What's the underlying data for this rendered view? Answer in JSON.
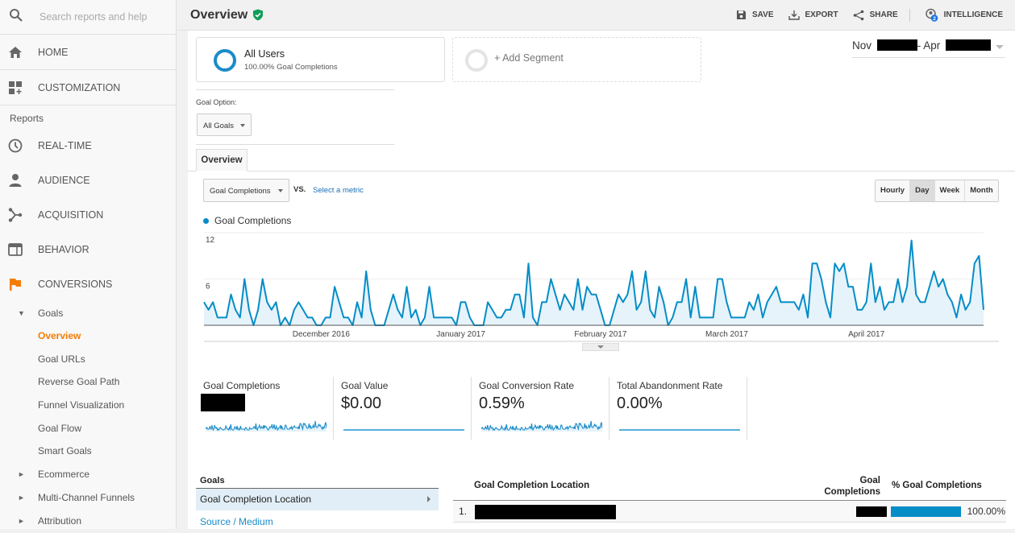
{
  "sidebar": {
    "search_placeholder": "Search reports and help",
    "top_items": [
      {
        "label": "HOME",
        "icon": "home-icon"
      },
      {
        "label": "CUSTOMIZATION",
        "icon": "dashboard-add-icon"
      }
    ],
    "reports_label": "Reports",
    "report_items": [
      {
        "label": "REAL-TIME",
        "icon": "clock-icon"
      },
      {
        "label": "AUDIENCE",
        "icon": "person-icon"
      },
      {
        "label": "ACQUISITION",
        "icon": "acquisition-icon"
      },
      {
        "label": "BEHAVIOR",
        "icon": "browser-window-icon"
      },
      {
        "label": "CONVERSIONS",
        "icon": "flag-icon"
      }
    ],
    "goals_label": "Goals",
    "goal_items": [
      "Overview",
      "Goal URLs",
      "Reverse Goal Path",
      "Funnel Visualization",
      "Goal Flow",
      "Smart Goals"
    ],
    "active_goal_item": "Overview",
    "collapsed_items": [
      "Ecommerce",
      "Multi-Channel Funnels",
      "Attribution"
    ]
  },
  "header": {
    "title": "Overview",
    "actions": [
      {
        "label": "SAVE",
        "icon": "save-icon"
      },
      {
        "label": "EXPORT",
        "icon": "export-icon"
      },
      {
        "label": "SHARE",
        "icon": "share-icon"
      },
      {
        "label": "INTELLIGENCE",
        "icon": "intelligence-icon",
        "badge": "2"
      }
    ]
  },
  "segments": {
    "active": {
      "name": "All Users",
      "subtitle": "100.00% Goal Completions"
    },
    "add_label": "+ Add Segment"
  },
  "date_range": {
    "start_prefix": "Nov",
    "end_prefix": "- Apr"
  },
  "goal_option": {
    "label": "Goal Option:",
    "selected": "All Goals"
  },
  "tabs": [
    {
      "label": "Overview"
    }
  ],
  "chart_controls": {
    "metric": "Goal Completions",
    "vs_label": "VS.",
    "select_metric": "Select a metric",
    "granularity": [
      "Hourly",
      "Day",
      "Week",
      "Month"
    ],
    "active_granularity": "Day"
  },
  "chart_data": {
    "type": "area",
    "title": "",
    "legend": [
      "Goal Completions"
    ],
    "legend_position": "top-left",
    "series_color": "#058dc7",
    "y_ticks": [
      6,
      12
    ],
    "ylim": [
      0,
      12
    ],
    "x_labels": [
      "December 2016",
      "January 2017",
      "February 2017",
      "March 2017",
      "April 2017"
    ],
    "x_label_days": [
      26,
      57,
      88,
      116,
      147
    ],
    "grid": true,
    "series": [
      {
        "name": "Goal Completions",
        "values": [
          3,
          2,
          3,
          1,
          1,
          1,
          4,
          2,
          1,
          6,
          2,
          0,
          2,
          6,
          3,
          2,
          3,
          0,
          1,
          0,
          2,
          3,
          2,
          1,
          1,
          0,
          0,
          1,
          1,
          5,
          3,
          1,
          1,
          0,
          3,
          1,
          7,
          2,
          0,
          0,
          0,
          2,
          4,
          2,
          1,
          5,
          1,
          2,
          0,
          1,
          5,
          1,
          1,
          1,
          1,
          1,
          0,
          3,
          3,
          1,
          0,
          0,
          0,
          3,
          2,
          1,
          1,
          2,
          2,
          4,
          4,
          1,
          8,
          1,
          0,
          3,
          3,
          6,
          4,
          2,
          4,
          3,
          2,
          6,
          2,
          5,
          4,
          4,
          2,
          0,
          0,
          2,
          4,
          3,
          4,
          7,
          2,
          3,
          7,
          2,
          1,
          5,
          3,
          0,
          1,
          3,
          3,
          6,
          1,
          5,
          1,
          1,
          1,
          1,
          6,
          6,
          3,
          1,
          1,
          1,
          1,
          3,
          2,
          4,
          1,
          3,
          4,
          5,
          3,
          3,
          3,
          3,
          2,
          4,
          1,
          8,
          8,
          6,
          3,
          1,
          8,
          7,
          8,
          5,
          5,
          2,
          2,
          3,
          8,
          3,
          5,
          2,
          3,
          3,
          6,
          3,
          5,
          11,
          4,
          3,
          3,
          5,
          7,
          5,
          6,
          4,
          3,
          1,
          4,
          2,
          3,
          8,
          9,
          2
        ]
      }
    ]
  },
  "scorecards": [
    {
      "label": "Goal Completions",
      "value": null,
      "redacted": true,
      "sparkline": "varied"
    },
    {
      "label": "Goal Value",
      "value": "$0.00",
      "sparkline": "flat"
    },
    {
      "label": "Goal Conversion Rate",
      "value": "0.59%",
      "sparkline": "varied"
    },
    {
      "label": "Total Abandonment Rate",
      "value": "0.00%",
      "sparkline": "flat"
    }
  ],
  "goals_panel": {
    "header": "Goals",
    "selected": "Goal Completion Location",
    "links": [
      "Source / Medium"
    ]
  },
  "table": {
    "columns": [
      "Goal Completion Location",
      "Goal Completions",
      "% Goal Completions"
    ],
    "rows": [
      {
        "rank": "1.",
        "location": null,
        "goal_completions": null,
        "percent": "100.00%",
        "percent_fraction": 1.0
      }
    ]
  }
}
